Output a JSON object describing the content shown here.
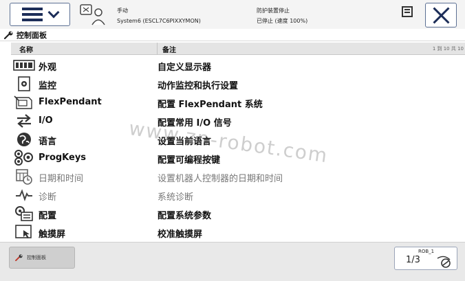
{
  "topbar": {
    "mode": "手动",
    "system": "System6 (ESCL7C6PIXXYMON)",
    "safety_status": "防护装置停止",
    "run_state": "已停止 (速度 100%)"
  },
  "window": {
    "title": "控制面板"
  },
  "columns": {
    "name": "名称",
    "note": "备注",
    "count": "1 到 10 共 10"
  },
  "rows": [
    {
      "icon": "display-icon",
      "name": "外观",
      "desc": "自定义显示器",
      "enabled": true
    },
    {
      "icon": "monitor-icon",
      "name": "监控",
      "desc": "动作监控和执行设置",
      "enabled": true
    },
    {
      "icon": "flexpendant-icon",
      "name": "FlexPendant",
      "desc": "配置 FlexPendant 系统",
      "enabled": true
    },
    {
      "icon": "io-arrows-icon",
      "name": "I/O",
      "desc": "配置常用 I/O 信号",
      "enabled": true
    },
    {
      "icon": "globe-icon",
      "name": "语言",
      "desc": "设置当前语言",
      "enabled": true
    },
    {
      "icon": "progkeys-icon",
      "name": "ProgKeys",
      "desc": "配置可编程按键",
      "enabled": true
    },
    {
      "icon": "calendar-clock-icon",
      "name": "日期和时间",
      "desc": "设置机器人控制器的日期和时间",
      "enabled": false
    },
    {
      "icon": "pulse-icon",
      "name": "诊断",
      "desc": "系统诊断",
      "enabled": false
    },
    {
      "icon": "config-icon",
      "name": "配置",
      "desc": "配置系统参数",
      "enabled": true
    },
    {
      "icon": "touchscreen-icon",
      "name": "触摸屏",
      "desc": "校准触摸屏",
      "enabled": true
    }
  ],
  "watermark": "www.zn-robot.com",
  "bottombar": {
    "task_label": "控制面板",
    "rob_label": "ROB_1",
    "fraction": "1/3"
  }
}
